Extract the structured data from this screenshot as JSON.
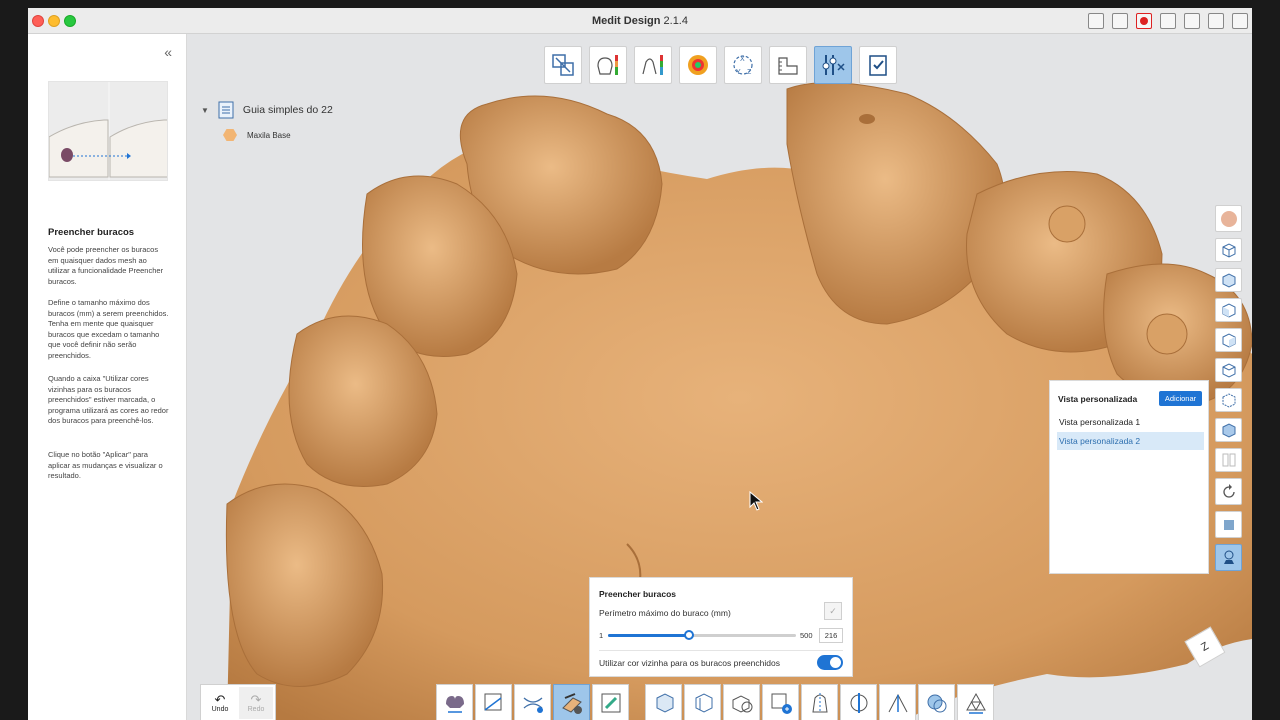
{
  "window": {
    "app_name": "Medit Design",
    "version": "2.1.4"
  },
  "left_panel": {
    "collapse_glyph": "«",
    "title": "Preencher buracos",
    "paragraphs": [
      "Você pode preencher os buracos em quaisquer dados mesh ao utilizar a funcionalidade Preencher buracos.",
      "Define o tamanho máximo dos buracos (mm) a serem preenchidos. Tenha em mente que quaisquer buracos que excedam o tamanho que você definir não serão preenchidos.",
      "Quando a caixa \"Utilizar cores vizinhas para os buracos preenchidos\" estiver marcada, o programa utilizará as cores ao redor dos buracos para preenchê-los.",
      "Clique no botão \"Aplicar\" para aplicar as mudanças e visualizar o resultado."
    ]
  },
  "tree": {
    "project_name": "Guia simples do 22",
    "items": [
      {
        "label": "Maxila Base",
        "color": "#f2b574"
      }
    ]
  },
  "custom_views": {
    "title": "Vista personalizada",
    "add_label": "Adicionar",
    "items": [
      {
        "label": "Vista personalizada 1",
        "selected": false
      },
      {
        "label": "Vista personalizada 2",
        "selected": true
      }
    ]
  },
  "fill_holes": {
    "title": "Preencher buracos",
    "perimeter_label": "Perímetro máximo do buraco (mm)",
    "min": "1",
    "max": "500",
    "value": "216",
    "checkbox_glyph": "✓",
    "neighbor_color_label": "Utilizar cor vizinha para os buracos preenchidos",
    "neighbor_color_enabled": true
  },
  "undo_redo": {
    "undo_label": "Undo",
    "redo_label": "Redo",
    "redo_enabled": false
  },
  "axis_label": "Z",
  "colors": {
    "accent": "#1f74d4",
    "active_tool": "#9ec6ea",
    "model": "#d9a166",
    "background": "#e3e4e6"
  }
}
